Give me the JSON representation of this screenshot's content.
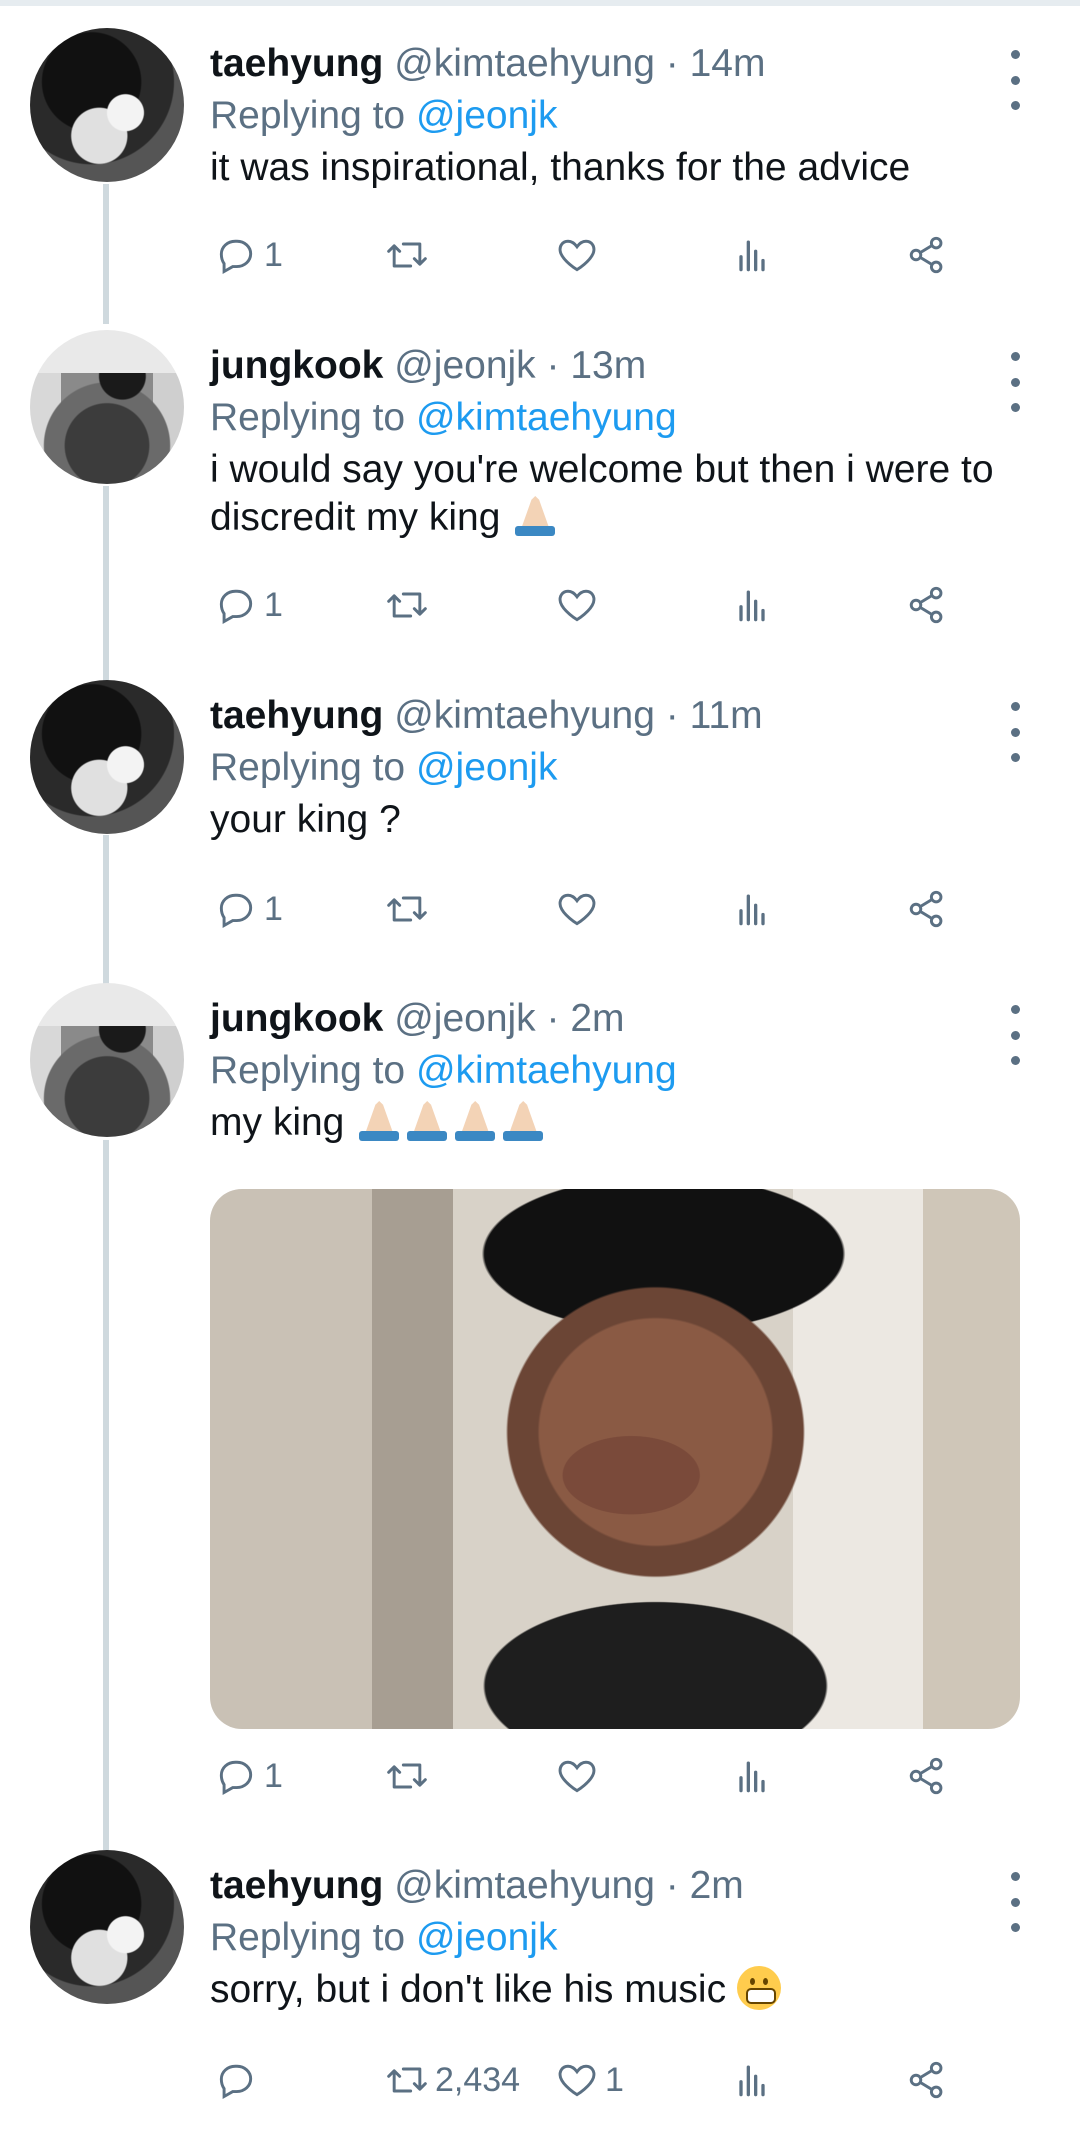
{
  "ui": {
    "replying_to": "Replying to",
    "dot": " · ",
    "colors": {
      "text": "#0f1419",
      "secondary": "#5b7083",
      "link": "#1d9bf0",
      "thread_line": "#cfd9de"
    }
  },
  "tweets": [
    {
      "name": "taehyung",
      "handle": "@kimtaehyung",
      "time": "14m",
      "reply_to": "@jeonjk",
      "text": "it was inspirational, thanks for the advice",
      "replies": "1"
    },
    {
      "name": "jungkook",
      "handle": "@jeonjk",
      "time": "13m",
      "reply_to": "@kimtaehyung",
      "text": "i would say you're welcome but then i were to discredit my king",
      "replies": "1"
    },
    {
      "name": "taehyung",
      "handle": "@kimtaehyung",
      "time": "11m",
      "reply_to": "@jeonjk",
      "text": "your king ?",
      "replies": "1"
    },
    {
      "name": "jungkook",
      "handle": "@jeonjk",
      "time": "2m",
      "reply_to": "@kimtaehyung",
      "text": "my king",
      "replies": "1"
    },
    {
      "name": "taehyung",
      "handle": "@kimtaehyung",
      "time": "2m",
      "reply_to": "@jeonjk",
      "text": "sorry, but i don't like his music",
      "retweets": "2,434",
      "likes": "1"
    }
  ]
}
